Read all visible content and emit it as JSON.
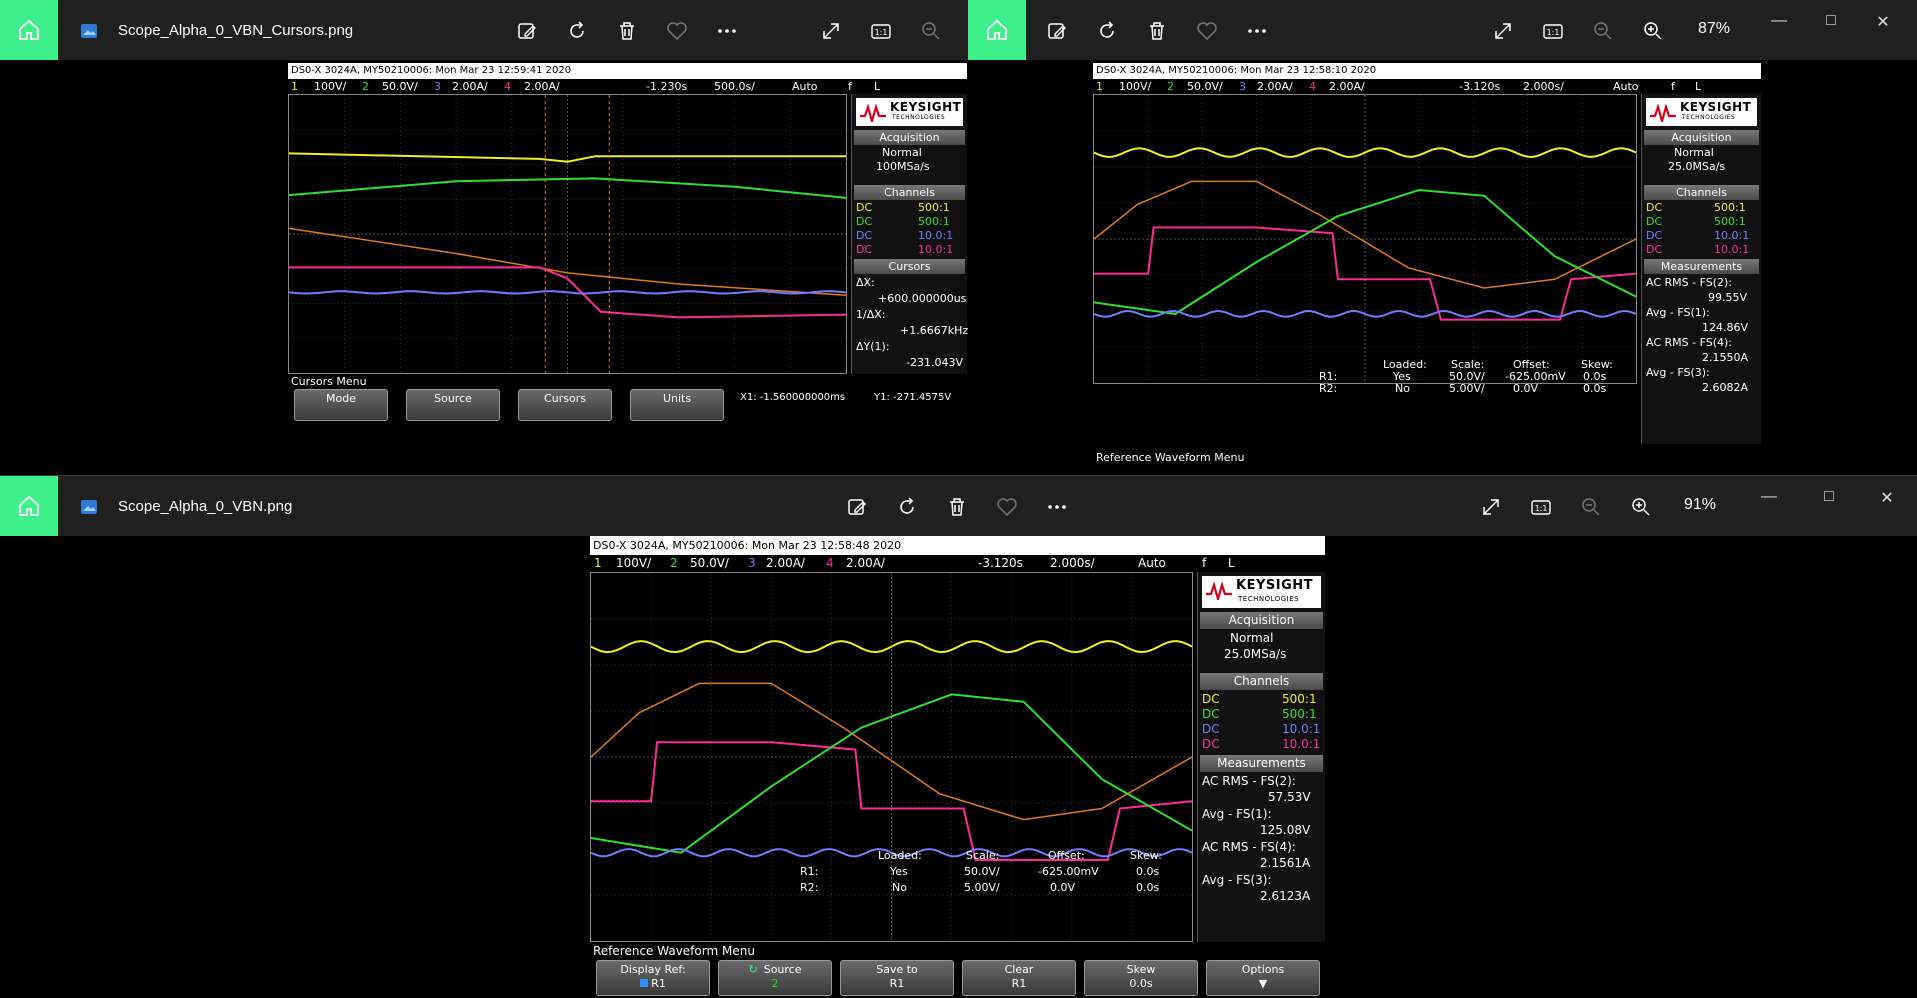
{
  "colors": {
    "ch1": "#f0f020",
    "ch2": "#30e030",
    "ch3": "#6f7fff",
    "ch4": "#ff2a9a",
    "ref": "#e07a20",
    "accent": "#3df08a"
  },
  "windows": {
    "cursors": {
      "file_name": "Scope_Alpha_0_VBN_Cursors.png",
      "scope": {
        "header": "DS0-X 3024A, MY50210006: Mon Mar 23 12:59:41 2020",
        "chbar": [
          "1",
          "100V/",
          "2",
          "50.0V/",
          "3",
          "2.00A/",
          "4",
          "2.00A/",
          "-1.230s",
          "500.0s/",
          "Auto",
          "f",
          "L"
        ],
        "acq_title": "Acquisition",
        "acq_mode": "Normal",
        "acq_rate": "100MSa/s",
        "channels_title": "Channels",
        "channels": [
          {
            "c": "DC",
            "r": "500:1"
          },
          {
            "c": "DC",
            "r": "500:1"
          },
          {
            "c": "DC",
            "r": "10.0:1"
          },
          {
            "c": "DC",
            "r": "10.0:1"
          }
        ],
        "cursors_title": "Cursors",
        "dx_label": "ΔX:",
        "dx_value": "+600.000000us",
        "inv_label": "1/ΔX:",
        "inv_value": "+1.6667kHz",
        "dy_label": "ΔY(1):",
        "dy_value": "-231.043V",
        "menu_label": "Cursors Menu",
        "softkeys": [
          "Mode",
          "Source",
          "Cursors",
          "Units"
        ],
        "x1_readout": "X1: -1.560000000ms",
        "y1_readout": "Y1: -271.4575V"
      }
    },
    "topright": {
      "zoom": "87%",
      "scope": {
        "header": "DS0-X 3024A, MY50210006: Mon Mar 23 12:58:10 2020",
        "chbar": [
          "1",
          "100V/",
          "2",
          "50.0V/",
          "3",
          "2.00A/",
          "4",
          "2.00A/",
          "-3.120s",
          "2.000s/",
          "Auto",
          "f",
          "L"
        ],
        "acq_title": "Acquisition",
        "acq_mode": "Normal",
        "acq_rate": "25.0MSa/s",
        "channels_title": "Channels",
        "channels": [
          {
            "c": "DC",
            "r": "500:1"
          },
          {
            "c": "DC",
            "r": "500:1"
          },
          {
            "c": "DC",
            "r": "10.0:1"
          },
          {
            "c": "DC",
            "r": "10.0:1"
          }
        ],
        "meas_title": "Measurements",
        "measurements": [
          {
            "label": "AC RMS - FS(2):",
            "value": "99.55V"
          },
          {
            "label": "Avg - FS(1):",
            "value": "124.86V"
          },
          {
            "label": "AC RMS - FS(4):",
            "value": "2.1550A"
          },
          {
            "label": "Avg - FS(3):",
            "value": "2.6082A"
          }
        ],
        "ref_table": {
          "headers": [
            "Loaded:",
            "Scale:",
            "Offset:",
            "Skew:"
          ],
          "r1": [
            "R1:",
            "Yes",
            "50.0V/",
            "-625.00mV",
            "0.0s"
          ],
          "r2": [
            "R2:",
            "No",
            "5.00V/",
            "0.0V",
            "0.0s"
          ]
        },
        "menu_label": "Reference Waveform Menu"
      }
    },
    "main": {
      "file_name": "Scope_Alpha_0_VBN.png",
      "zoom": "91%",
      "scope": {
        "header": "DS0-X 3024A, MY50210006: Mon Mar 23 12:58:48 2020",
        "chbar": [
          "1",
          "100V/",
          "2",
          "50.0V/",
          "3",
          "2.00A/",
          "4",
          "2.00A/",
          "-3.120s",
          "2.000s/",
          "Auto",
          "f",
          "L"
        ],
        "acq_title": "Acquisition",
        "acq_mode": "Normal",
        "acq_rate": "25.0MSa/s",
        "channels_title": "Channels",
        "channels": [
          {
            "c": "DC",
            "r": "500:1"
          },
          {
            "c": "DC",
            "r": "500:1"
          },
          {
            "c": "DC",
            "r": "10.0:1"
          },
          {
            "c": "DC",
            "r": "10.0:1"
          }
        ],
        "meas_title": "Measurements",
        "measurements": [
          {
            "label": "AC RMS - FS(2):",
            "value": "57.53V"
          },
          {
            "label": "Avg - FS(1):",
            "value": "125.08V"
          },
          {
            "label": "AC RMS - FS(4):",
            "value": "2.1561A"
          },
          {
            "label": "Avg - FS(3):",
            "value": "2.6123A"
          }
        ],
        "ref_table": {
          "headers": [
            "Loaded:",
            "Scale:",
            "Offset:",
            "Skew:"
          ],
          "r1": [
            "R1:",
            "Yes",
            "50.0V/",
            "-625.00mV",
            "0.0s"
          ],
          "r2": [
            "R2:",
            "No",
            "5.00V/",
            "0.0V",
            "0.0s"
          ]
        },
        "menu_label": "Reference Waveform Menu",
        "softkeys": [
          {
            "label": "Display Ref:",
            "value": "R1"
          },
          {
            "label": "Source",
            "value": "2"
          },
          {
            "label": "Save to",
            "value": "R1"
          },
          {
            "label": "Clear",
            "value": "R1"
          },
          {
            "label": "Skew",
            "value": "0.0s"
          },
          {
            "label": "Options",
            "value": ""
          }
        ]
      }
    }
  },
  "brand": {
    "name": "KEYSIGHT",
    "sub": "TECHNOLOGIES"
  }
}
